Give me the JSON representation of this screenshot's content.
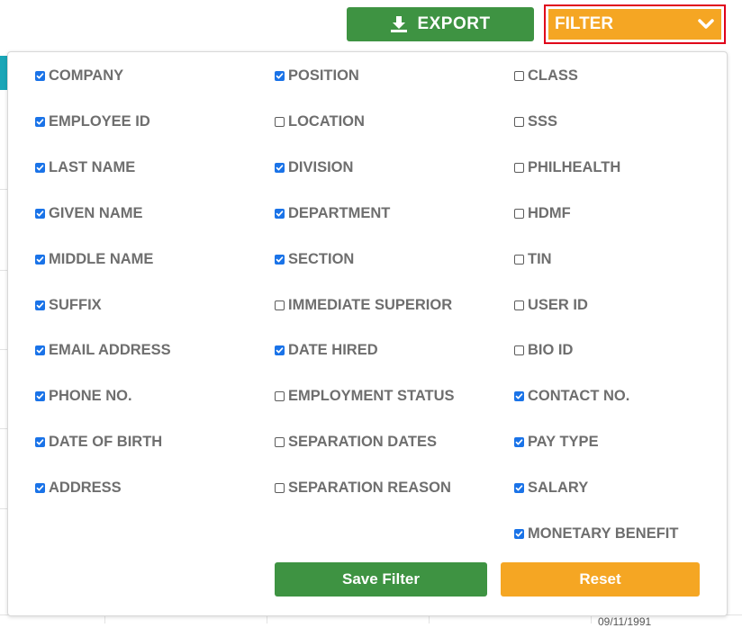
{
  "toolbar": {
    "export_label": "EXPORT",
    "filter_label": "FILTER"
  },
  "filter_panel": {
    "columns": [
      [
        {
          "label": "COMPANY",
          "checked": true
        },
        {
          "label": "EMPLOYEE ID",
          "checked": true
        },
        {
          "label": "LAST NAME",
          "checked": true
        },
        {
          "label": "GIVEN NAME",
          "checked": true
        },
        {
          "label": "MIDDLE NAME",
          "checked": true
        },
        {
          "label": "SUFFIX",
          "checked": true
        },
        {
          "label": "EMAIL ADDRESS",
          "checked": true
        },
        {
          "label": "PHONE NO.",
          "checked": true
        },
        {
          "label": "DATE OF BIRTH",
          "checked": true
        },
        {
          "label": "ADDRESS",
          "checked": true
        }
      ],
      [
        {
          "label": "POSITION",
          "checked": true
        },
        {
          "label": "LOCATION",
          "checked": false
        },
        {
          "label": "DIVISION",
          "checked": true
        },
        {
          "label": "DEPARTMENT",
          "checked": true
        },
        {
          "label": "SECTION",
          "checked": true
        },
        {
          "label": "IMMEDIATE SUPERIOR",
          "checked": false
        },
        {
          "label": "DATE HIRED",
          "checked": true
        },
        {
          "label": "EMPLOYMENT STATUS",
          "checked": false
        },
        {
          "label": "SEPARATION DATES",
          "checked": false
        },
        {
          "label": "SEPARATION REASON",
          "checked": false
        }
      ],
      [
        {
          "label": "CLASS",
          "checked": false
        },
        {
          "label": "SSS",
          "checked": false
        },
        {
          "label": "PHILHEALTH",
          "checked": false
        },
        {
          "label": "HDMF",
          "checked": false
        },
        {
          "label": "TIN",
          "checked": false
        },
        {
          "label": "USER ID",
          "checked": false
        },
        {
          "label": "BIO ID",
          "checked": false
        },
        {
          "label": "CONTACT NO.",
          "checked": true
        },
        {
          "label": "PAY TYPE",
          "checked": true
        },
        {
          "label": "SALARY",
          "checked": true
        },
        {
          "label": "MONETARY BENEFIT",
          "checked": true
        }
      ]
    ],
    "save_label": "Save Filter",
    "reset_label": "Reset"
  },
  "background": {
    "partial_date": "09/11/1991"
  },
  "colors": {
    "green": "#3e9342",
    "orange": "#f5a623",
    "checkbox_blue": "#1a73e8",
    "label_gray": "#6e6e6e",
    "highlight_red": "#e0001a"
  }
}
